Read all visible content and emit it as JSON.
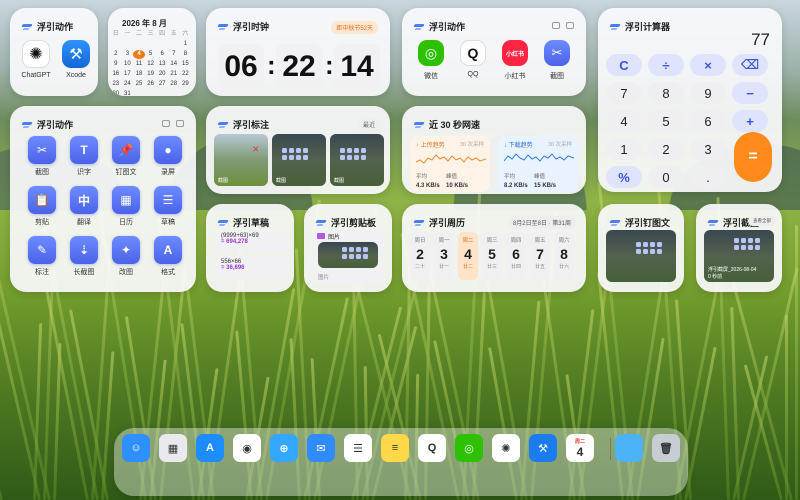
{
  "widgets": {
    "actions_small": {
      "title": "浮引动作",
      "apps": [
        {
          "label": "ChatGPT",
          "icon": "chatgpt-icon"
        },
        {
          "label": "Xcode",
          "icon": "xcode-icon"
        }
      ]
    },
    "calendar": {
      "title": "2026 年 8 月",
      "weekdays": [
        "日",
        "一",
        "二",
        "三",
        "四",
        "五",
        "六"
      ],
      "days": [
        "",
        "",
        "",
        "",
        "",
        "",
        "1",
        "2",
        "3",
        "4",
        "5",
        "6",
        "7",
        "8",
        "9",
        "10",
        "11",
        "12",
        "13",
        "14",
        "15",
        "16",
        "17",
        "18",
        "19",
        "20",
        "21",
        "22",
        "23",
        "24",
        "25",
        "26",
        "27",
        "28",
        "29",
        "30",
        "31",
        "",
        "",
        "",
        "",
        ""
      ],
      "today": "4"
    },
    "clock": {
      "title": "浮引时钟",
      "badge": "距中秋节52天",
      "hours": "06",
      "minutes": "22",
      "seconds": "14"
    },
    "actions_mid": {
      "title": "浮引动作",
      "apps": [
        {
          "label": "微信",
          "icon": "wechat-icon",
          "color": "#2dc100"
        },
        {
          "label": "QQ",
          "icon": "qq-icon",
          "color": "#111111"
        },
        {
          "label": "小红书",
          "icon": "xiaohongshu-icon",
          "color": "#ff2442",
          "text": "小红书"
        },
        {
          "label": "截图",
          "icon": "screenshot-icon",
          "color": "#5b73f0"
        }
      ]
    },
    "calculator": {
      "title": "浮引计算器",
      "display": "77",
      "keys": [
        [
          "C",
          "÷",
          "×",
          "⌫"
        ],
        [
          "7",
          "8",
          "9",
          "−"
        ],
        [
          "4",
          "5",
          "6",
          "+"
        ],
        [
          "1",
          "2",
          "3",
          "="
        ],
        [
          "%",
          "0",
          "."
        ]
      ]
    },
    "tools": {
      "title": "浮引动作",
      "items": [
        {
          "label": "截图",
          "glyph": "✂"
        },
        {
          "label": "识字",
          "glyph": "T"
        },
        {
          "label": "钉图文",
          "glyph": "📌"
        },
        {
          "label": "录屏",
          "glyph": "●"
        },
        {
          "label": "剪贴",
          "glyph": "📋"
        },
        {
          "label": "翻译",
          "glyph": "中"
        },
        {
          "label": "日历",
          "glyph": "▦"
        },
        {
          "label": "草稿",
          "glyph": "☰"
        },
        {
          "label": "标注",
          "glyph": "✎"
        },
        {
          "label": "长截图",
          "glyph": "⇣"
        },
        {
          "label": "改图",
          "glyph": "✦"
        },
        {
          "label": "格式",
          "glyph": "A"
        }
      ]
    },
    "annotate": {
      "title": "浮引标注",
      "badge": "最近",
      "thumbs": [
        "截图",
        "截图",
        "截图"
      ]
    },
    "network": {
      "title": "近 30 秒网速",
      "up": {
        "label": "上传趋势",
        "period": "30 次采样",
        "avg_label": "平均",
        "peak_label": "峰值",
        "avg": "4.3 KB/s",
        "peak": "10 KB/s"
      },
      "down": {
        "label": "下载趋势",
        "period": "30 次采样",
        "avg_label": "平均",
        "peak_label": "峰值",
        "avg": "8.2 KB/s",
        "peak": "15 KB/s"
      }
    },
    "drafts": {
      "title": "浮引草稿",
      "items": [
        {
          "expr": "(9999+63)×69",
          "result": "= 694,278"
        },
        {
          "expr": "556×66",
          "result": "= 36,696"
        }
      ]
    },
    "clipboard": {
      "title": "浮引剪贴板",
      "item_label": "图片",
      "footer": "图片"
    },
    "week": {
      "title": "浮引周历",
      "badge": "8月2日至8日 · 第31周",
      "days": [
        {
          "w": "周日",
          "n": "2",
          "l": "二十"
        },
        {
          "w": "周一",
          "n": "3",
          "l": "廿一"
        },
        {
          "w": "周二",
          "n": "4",
          "l": "廿二"
        },
        {
          "w": "周三",
          "n": "5",
          "l": "廿三"
        },
        {
          "w": "周四",
          "n": "6",
          "l": "廿四"
        },
        {
          "w": "周五",
          "n": "7",
          "l": "廿五"
        },
        {
          "w": "周六",
          "n": "8",
          "l": "廿六"
        }
      ],
      "selected": 2
    },
    "pin": {
      "title": "浮引钉图文"
    },
    "screenshot": {
      "title": "浮引截图",
      "badge": "查看全部",
      "caption": "浮引截屏_2026-08-04",
      "sub": "0 秒前"
    }
  },
  "dock": {
    "apps": [
      {
        "name": "finder-icon",
        "color": "#2f8fff",
        "text": "☺"
      },
      {
        "name": "launchpad-icon",
        "color": "#e9e9ee",
        "text": "▦"
      },
      {
        "name": "app-store-icon",
        "color": "#1c8cff",
        "text": "A"
      },
      {
        "name": "chrome-icon",
        "color": "#ffffff",
        "text": "◉"
      },
      {
        "name": "safari-icon",
        "color": "#34a7ff",
        "text": "⊕"
      },
      {
        "name": "mail-icon",
        "color": "#2f8bff",
        "text": "✉"
      },
      {
        "name": "reminders-icon",
        "color": "#ffffff",
        "text": "☰"
      },
      {
        "name": "notes-icon",
        "color": "#ffd84a",
        "text": "≡"
      },
      {
        "name": "qq-icon",
        "color": "#ffffff",
        "text": "Q"
      },
      {
        "name": "wechat-icon",
        "color": "#2dc100",
        "text": "◎"
      },
      {
        "name": "chatgpt-icon",
        "color": "#ffffff",
        "text": "✺"
      },
      {
        "name": "xcode-icon",
        "color": "#1b7cf0",
        "text": "⚒"
      },
      {
        "name": "calendar-icon",
        "color": "#ffffff",
        "text": "4",
        "sub": "周二"
      },
      {
        "name": "folder-icon",
        "color": "#4ab3f5",
        "text": ""
      },
      {
        "name": "trash-icon",
        "color": "#c7cdd2",
        "text": "🗑"
      }
    ]
  }
}
